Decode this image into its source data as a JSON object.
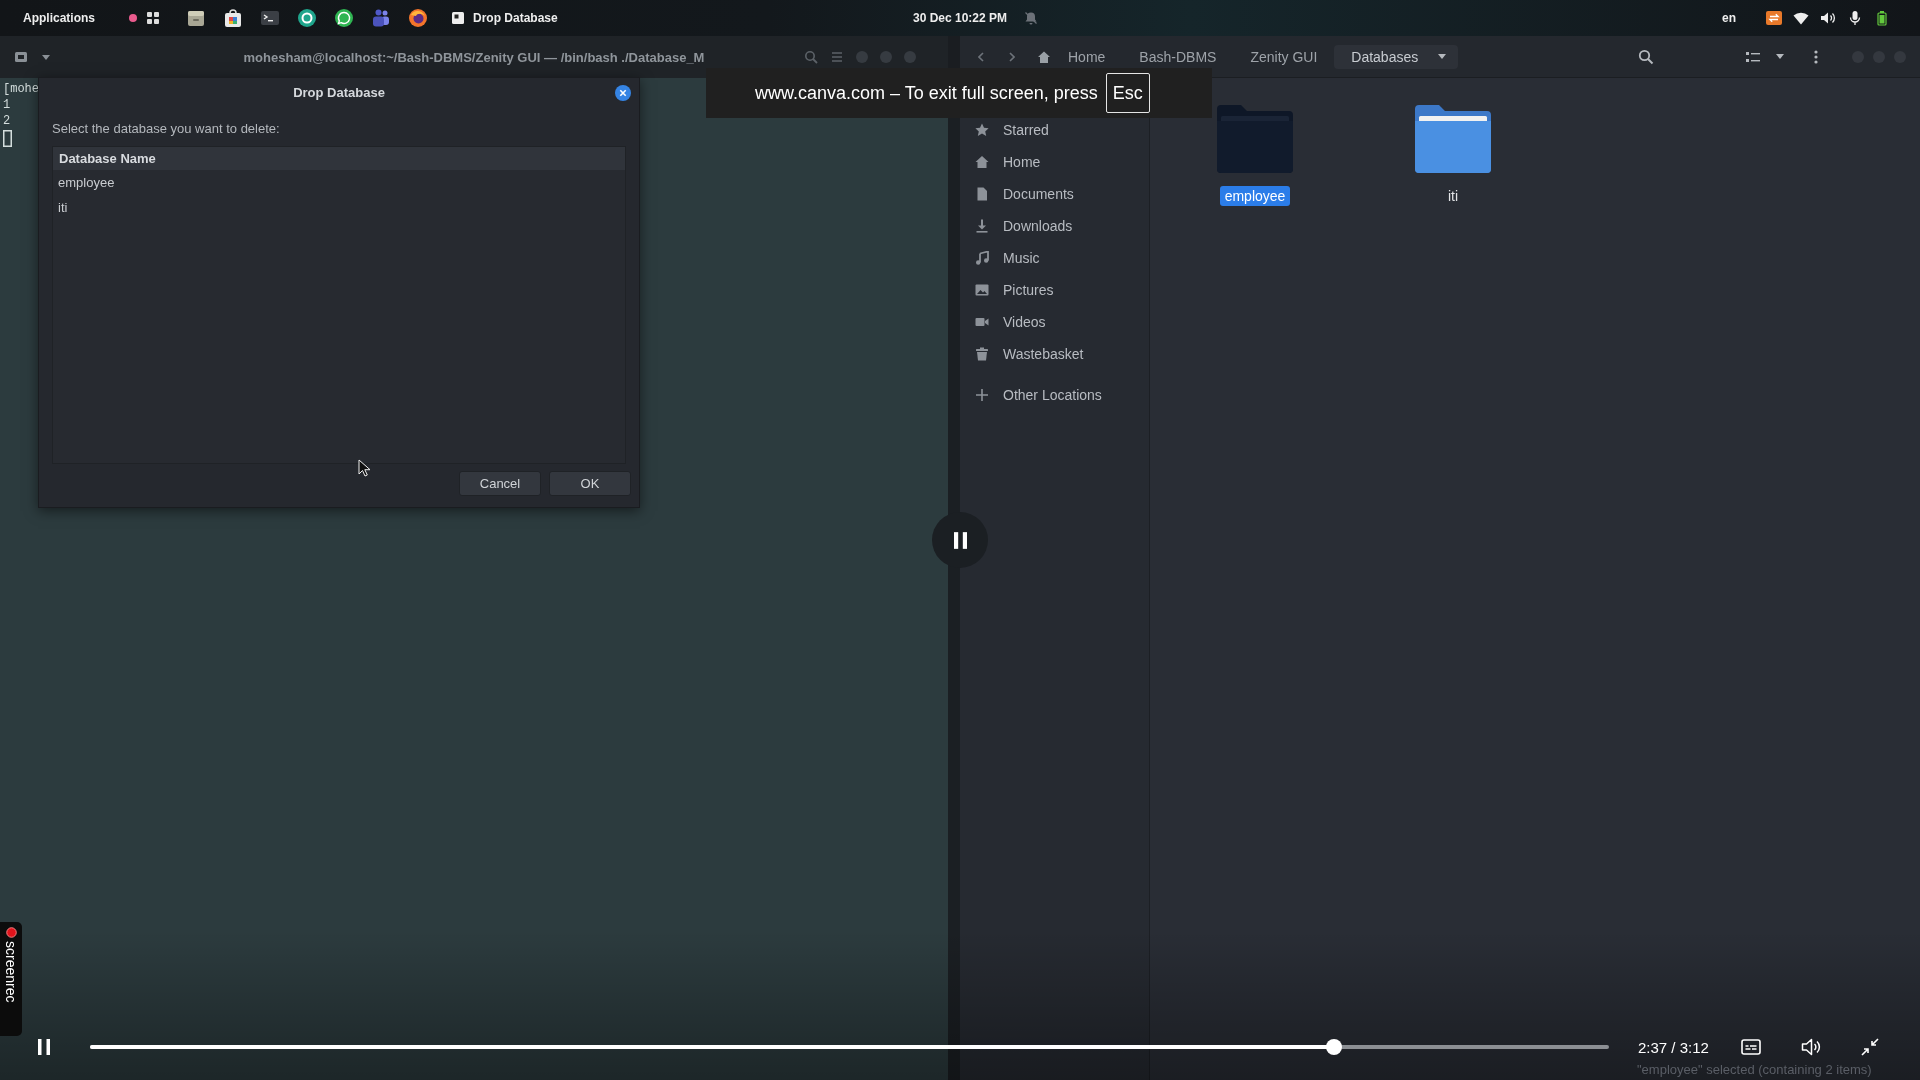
{
  "top_bar": {
    "menu": "Applications",
    "window_button": {
      "label": "Drop Database"
    },
    "clock": "30 Dec 10:22 PM",
    "keyboard_layout": "en"
  },
  "terminal": {
    "title": "mohesham@localhost:~/Bash-DBMS/Zenity GUI — /bin/bash ./Database_M",
    "lines": [
      "[mohe",
      "1",
      "2"
    ]
  },
  "dialog": {
    "title": "Drop Database",
    "prompt": "Select the database you want to delete:",
    "table": {
      "columns": [
        "Database Name"
      ],
      "rows": [
        {
          "cells": [
            "employee"
          ],
          "selected": false
        },
        {
          "cells": [
            "iti"
          ],
          "selected": false
        }
      ]
    },
    "buttons": [
      "Cancel",
      "OK"
    ]
  },
  "file_manager": {
    "path": [
      {
        "label": "Home",
        "selected": false
      },
      {
        "label": "Bash-DBMS",
        "selected": false
      },
      {
        "label": "Zenity GUI",
        "selected": false
      },
      {
        "label": "Databases",
        "selected": true
      }
    ],
    "sidebar": {
      "items": [
        {
          "kind": "star",
          "label": "Starred"
        },
        {
          "kind": "home",
          "label": "Home"
        },
        {
          "kind": "document",
          "label": "Documents"
        },
        {
          "kind": "download",
          "label": "Downloads"
        },
        {
          "kind": "music",
          "label": "Music"
        },
        {
          "kind": "picture",
          "label": "Pictures"
        },
        {
          "kind": "video",
          "label": "Videos"
        },
        {
          "kind": "trash",
          "label": "Wastebasket"
        },
        {
          "kind": "plus",
          "label": "Other Locations"
        }
      ]
    },
    "files": [
      {
        "name": "employee",
        "selected": true
      },
      {
        "name": "iti",
        "selected": false
      }
    ],
    "status": "\"employee\" selected (containing 2 items)"
  },
  "fullscreen_notice": {
    "text": "www.canva.com – To exit full screen, press",
    "key": "Esc"
  },
  "player": {
    "playing": true,
    "progress": {
      "level": 0.819
    },
    "time": "2:37 / 3:12"
  },
  "recorder_badge": {
    "label": "screenrec"
  }
}
